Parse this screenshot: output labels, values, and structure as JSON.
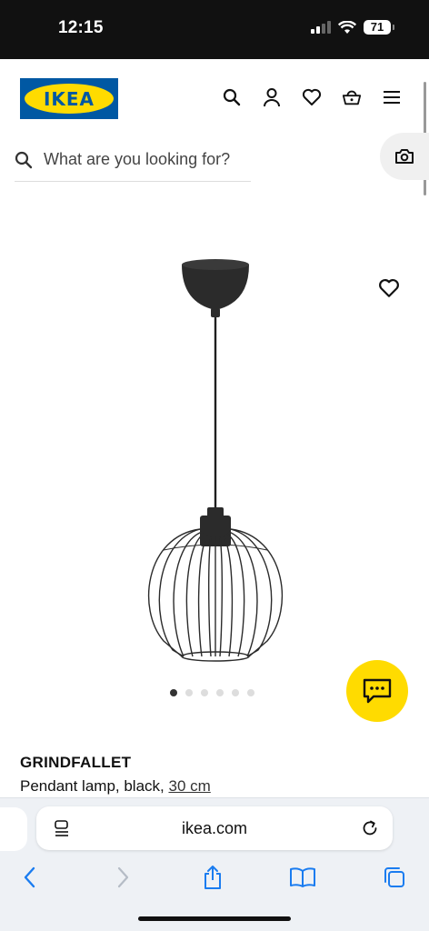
{
  "status_bar": {
    "time": "12:15",
    "battery": "71"
  },
  "header": {
    "logo_text": "IKEA"
  },
  "search": {
    "placeholder": "What are you looking for?"
  },
  "carousel": {
    "slides": 6,
    "active_index": 0
  },
  "product": {
    "name": "GRINDFALLET",
    "description": "Pendant lamp, black, ",
    "size": "30 cm"
  },
  "browser": {
    "url": "ikea.com"
  },
  "colors": {
    "ikea_blue": "#0058a3",
    "ikea_yellow": "#ffdb00",
    "lamp_black": "#2b2b2b"
  },
  "icons": {
    "header": [
      "search-icon",
      "user-icon",
      "heart-icon",
      "basket-icon",
      "menu-icon"
    ],
    "browser_nav": [
      "back-icon",
      "forward-icon",
      "share-icon",
      "bookmarks-icon",
      "tabs-icon"
    ]
  }
}
